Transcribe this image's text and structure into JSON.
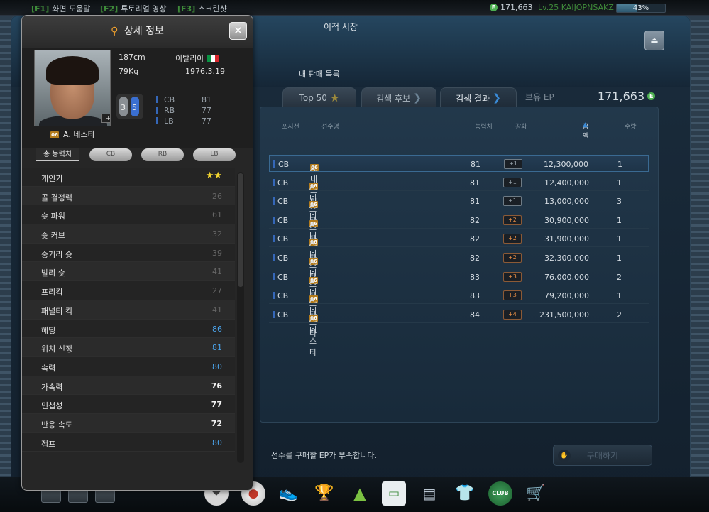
{
  "topbar": {
    "help_key": "[F1]",
    "help_label": "화면 도움말",
    "tutorial_key": "[F2]",
    "tutorial_label": "튜토리얼 영상",
    "screenshot_key": "[F3]",
    "screenshot_label": "스크린샷",
    "ep": "171,663",
    "level": "Lv.25 KAIJOPNSAKZ",
    "xp_percent": "43%",
    "xp_fraction": 0.43
  },
  "main": {
    "title": "이적 시장",
    "sell_list": "내 판매 목록",
    "tabs": [
      {
        "label": "Top 50"
      },
      {
        "label": "검색 후보"
      },
      {
        "label": "검색 결과"
      }
    ],
    "ep_label": "보유 EP",
    "ep_value": "171,663",
    "notice": "선수를 구매할 EP가 부족합니다.",
    "buy_label": "구매하기"
  },
  "results": {
    "headers": {
      "position": "포지션",
      "name": "선수명",
      "ovr": "능력치",
      "enhance": "강화",
      "price": "금액",
      "qty": "수량"
    },
    "rows": [
      {
        "pos": "CB",
        "season": "06",
        "name": "A. 네스타",
        "ovr": "81",
        "enh": "+1",
        "price": "12,300,000",
        "qty": "1"
      },
      {
        "pos": "CB",
        "season": "06",
        "name": "A. 네스타",
        "ovr": "81",
        "enh": "+1",
        "price": "12,400,000",
        "qty": "1"
      },
      {
        "pos": "CB",
        "season": "06",
        "name": "A. 네스타",
        "ovr": "81",
        "enh": "+1",
        "price": "13,000,000",
        "qty": "3"
      },
      {
        "pos": "CB",
        "season": "06",
        "name": "A. 네스타",
        "ovr": "82",
        "enh": "+2",
        "price": "30,900,000",
        "qty": "1"
      },
      {
        "pos": "CB",
        "season": "06",
        "name": "A. 네스타",
        "ovr": "82",
        "enh": "+2",
        "price": "31,900,000",
        "qty": "1"
      },
      {
        "pos": "CB",
        "season": "06",
        "name": "A. 네스타",
        "ovr": "82",
        "enh": "+2",
        "price": "32,300,000",
        "qty": "1"
      },
      {
        "pos": "CB",
        "season": "06",
        "name": "A. 네스타",
        "ovr": "83",
        "enh": "+3",
        "price": "76,000,000",
        "qty": "2"
      },
      {
        "pos": "CB",
        "season": "06",
        "name": "A. 네스타",
        "ovr": "83",
        "enh": "+3",
        "price": "79,200,000",
        "qty": "1"
      },
      {
        "pos": "CB",
        "season": "06",
        "name": "A. 네스타",
        "ovr": "84",
        "enh": "+4",
        "price": "231,500,000",
        "qty": "2"
      }
    ]
  },
  "detail": {
    "title": "상세 정보",
    "player": {
      "name": "A. 네스타",
      "season": "06",
      "enhance": "+1",
      "height": "187cm",
      "weight": "79Kg",
      "nation": "이탈리아",
      "dob": "1976.3.19",
      "weak_foot": "3",
      "strong_foot": "5",
      "positions": [
        {
          "pos": "CB",
          "val": "81"
        },
        {
          "pos": "RB",
          "val": "77"
        },
        {
          "pos": "LB",
          "val": "77"
        }
      ]
    },
    "tabs": [
      "총 능력치",
      "CB",
      "RB",
      "LB"
    ],
    "stats": [
      {
        "label": "개인기",
        "value": "★★",
        "style": "stars"
      },
      {
        "label": "골 결정력",
        "value": "26",
        "style": "dim"
      },
      {
        "label": "슛 파워",
        "value": "61",
        "style": "dim"
      },
      {
        "label": "슛 커브",
        "value": "32",
        "style": "dim"
      },
      {
        "label": "중거리 슛",
        "value": "39",
        "style": "dim"
      },
      {
        "label": "발리 슛",
        "value": "41",
        "style": "dim"
      },
      {
        "label": "프리킥",
        "value": "27",
        "style": "dim"
      },
      {
        "label": "패널티 킥",
        "value": "41",
        "style": "dim"
      },
      {
        "label": "헤딩",
        "value": "86",
        "style": "blue"
      },
      {
        "label": "위치 선정",
        "value": "81",
        "style": "blue"
      },
      {
        "label": "속력",
        "value": "80",
        "style": "blue"
      },
      {
        "label": "가속력",
        "value": "76",
        "style": "white"
      },
      {
        "label": "민첩성",
        "value": "77",
        "style": "white"
      },
      {
        "label": "반응 속도",
        "value": "72",
        "style": "white"
      },
      {
        "label": "점프",
        "value": "80",
        "style": "blue"
      }
    ]
  },
  "dock": {
    "items": [
      "whistle-icon",
      "ball-icon",
      "boots-icon",
      "trophy-icon",
      "ranking-icon",
      "stadium-icon",
      "notebook-icon",
      "jersey-icon",
      "club-icon",
      "cart-icon"
    ],
    "club_label": "CLUB"
  }
}
